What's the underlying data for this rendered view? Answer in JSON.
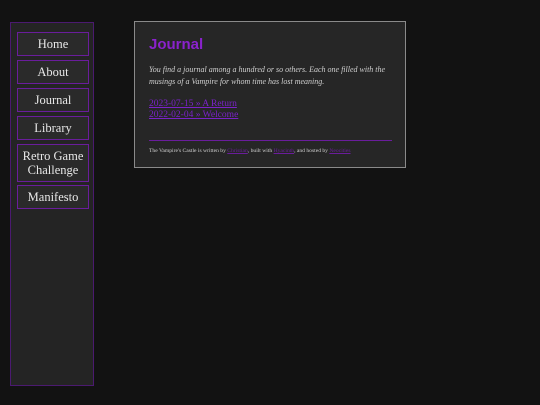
{
  "nav": {
    "items": [
      {
        "label": "Home"
      },
      {
        "label": "About"
      },
      {
        "label": "Journal"
      },
      {
        "label": "Library"
      },
      {
        "label": "Retro Game Challenge"
      },
      {
        "label": "Manifesto"
      }
    ]
  },
  "main": {
    "title": "Journal",
    "intro": "You find a journal among a hundred or so others. Each one filled with the musings of a Vampire for whom time has lost meaning.",
    "entries": [
      {
        "label": "2023-07-15 » A Return"
      },
      {
        "label": "2022-02-04 » Welcome"
      }
    ]
  },
  "footer": {
    "text_1": "The Vampire's Castle is written by ",
    "link_author": "Christian",
    "text_2": ", built with ",
    "link_builder": "Hyacinth",
    "text_3": ", and hosted by ",
    "link_host": "Neocities"
  }
}
